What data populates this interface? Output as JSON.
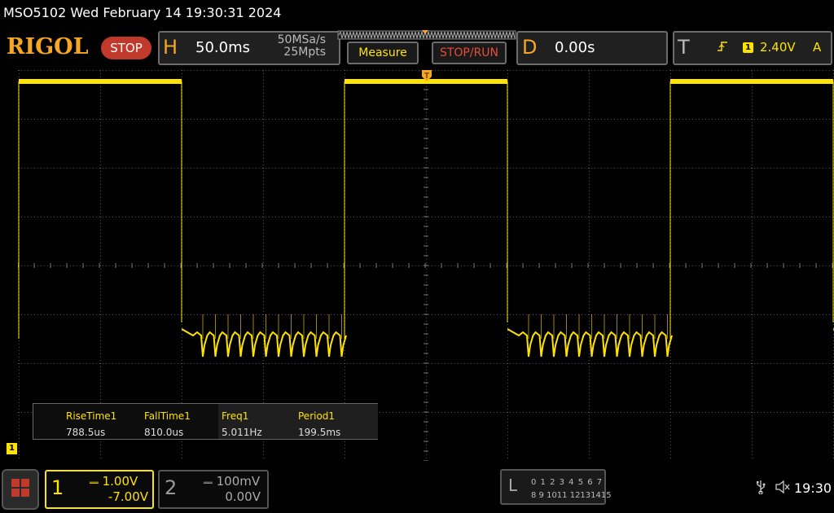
{
  "title_bar": {
    "text": "MSO5102  Wed February 14 19:30:31 2024"
  },
  "top_bar": {
    "logo": "RIGOL",
    "run_state": "STOP",
    "horizontal": {
      "letter": "H",
      "timebase": "50.0ms",
      "sample_rate": "50MSa/s",
      "memory_depth": "25Mpts"
    },
    "measure_label": "Measure",
    "stop_run_label": "STOP/RUN",
    "delay": {
      "letter": "D",
      "value": "0.00s"
    },
    "trigger": {
      "letter": "T",
      "source": "1",
      "level": "2.40V",
      "mode": "A"
    }
  },
  "measurements": [
    {
      "name": "RiseTime1",
      "value": "788.5us"
    },
    {
      "name": "FallTime1",
      "value": "810.0us"
    },
    {
      "name": "Freq1",
      "value": "5.011Hz"
    },
    {
      "name": "Period1",
      "value": "199.5ms"
    }
  ],
  "channels": {
    "ch1": {
      "number": "1",
      "scale": "1.00V",
      "offset": "-7.00V",
      "marker": "1",
      "color": "#ffe300"
    },
    "ch2": {
      "number": "2",
      "scale": "100mV",
      "offset": "0.00V"
    }
  },
  "logic_analyzer": {
    "letter": "L",
    "row1": "0 1 2 3  4 5 6 7",
    "row2": "8 9 1011 12131415"
  },
  "status": {
    "time": "19:30",
    "usb_icon": "usb-icon",
    "sound_icon": "mute-icon"
  },
  "waveform": {
    "type": "square",
    "frequency_hz": 5.011,
    "period_ms": 199.5,
    "timebase_ms_per_div": 50,
    "high_periods_ms": [
      [
        -250,
        -150
      ],
      [
        -50,
        50
      ],
      [
        150,
        250
      ]
    ],
    "low_ripple_count_per_period": 13,
    "color": "#ffe300"
  }
}
